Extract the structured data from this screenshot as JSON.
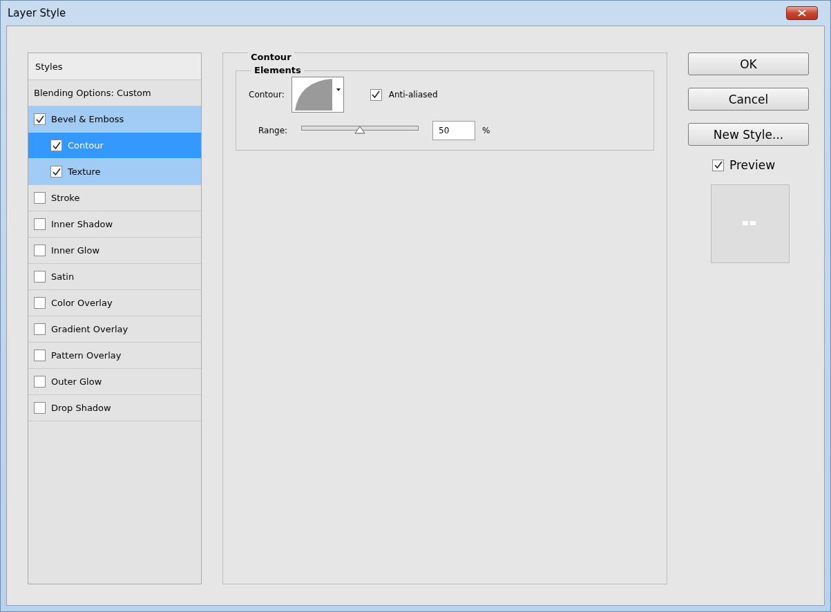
{
  "window": {
    "title": "Layer Style"
  },
  "styles": {
    "header": "Styles",
    "items": [
      {
        "kind": "option",
        "label": "Blending Options: Custom",
        "selected": false,
        "highlighted": false
      },
      {
        "kind": "effect",
        "label": "Bevel & Emboss",
        "checked": true,
        "selected": false,
        "highlighted": true,
        "children": [
          {
            "kind": "effect",
            "label": "Contour",
            "checked": true,
            "selected": true
          },
          {
            "kind": "effect",
            "label": "Texture",
            "checked": true,
            "selected": false,
            "highlighted": true
          }
        ]
      },
      {
        "kind": "effect",
        "label": "Stroke",
        "checked": false,
        "selected": false,
        "highlighted": false
      },
      {
        "kind": "effect",
        "label": "Inner Shadow",
        "checked": false,
        "selected": false,
        "highlighted": false
      },
      {
        "kind": "effect",
        "label": "Inner Glow",
        "checked": false,
        "selected": false,
        "highlighted": false
      },
      {
        "kind": "effect",
        "label": "Satin",
        "checked": false,
        "selected": false,
        "highlighted": false
      },
      {
        "kind": "effect",
        "label": "Color Overlay",
        "checked": false,
        "selected": false,
        "highlighted": false
      },
      {
        "kind": "effect",
        "label": "Gradient Overlay",
        "checked": false,
        "selected": false,
        "highlighted": false
      },
      {
        "kind": "effect",
        "label": "Pattern Overlay",
        "checked": false,
        "selected": false,
        "highlighted": false
      },
      {
        "kind": "effect",
        "label": "Outer Glow",
        "checked": false,
        "selected": false,
        "highlighted": false
      },
      {
        "kind": "effect",
        "label": "Drop Shadow",
        "checked": false,
        "selected": false,
        "highlighted": false
      }
    ]
  },
  "panel": {
    "title": "Contour",
    "group": {
      "title": "Elements",
      "contour": {
        "label": "Contour:"
      },
      "anti_aliased": {
        "label": "Anti-aliased",
        "checked": true
      },
      "range": {
        "label": "Range:",
        "level": 0.5,
        "value": "50",
        "unit": "%"
      }
    }
  },
  "buttons": [
    "OK",
    "Cancel",
    "New Style..."
  ],
  "preview": {
    "label": "Preview",
    "checked": true
  }
}
